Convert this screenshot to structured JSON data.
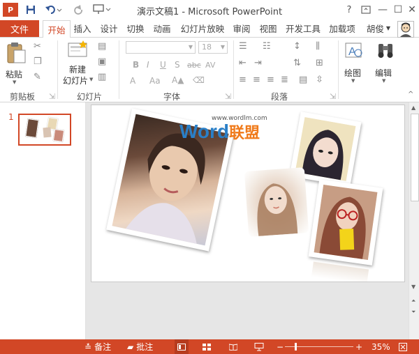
{
  "window": {
    "title": "演示文稿1 - Microsoft PowerPoint",
    "app_logo": "P",
    "help_glyph": "?",
    "minimize_glyph": "—",
    "maximize_glyph": "☐",
    "close_glyph": "✕",
    "accent": "#d24726"
  },
  "tabs": [
    {
      "label": "文件"
    },
    {
      "label": "开始"
    },
    {
      "label": "插入"
    },
    {
      "label": "设计"
    },
    {
      "label": "切换"
    },
    {
      "label": "动画"
    },
    {
      "label": "幻灯片放映"
    },
    {
      "label": "审阅"
    },
    {
      "label": "视图"
    },
    {
      "label": "开发工具"
    },
    {
      "label": "加载项"
    }
  ],
  "user": {
    "name": "胡俊"
  },
  "ribbon": {
    "paste_label": "粘贴",
    "new_slide_label_1": "新建",
    "new_slide_label_2": "幻灯片",
    "font_size_value": "18",
    "drawing_label": "绘图",
    "editing_label": "编辑",
    "groups": {
      "clipboard": "剪贴板",
      "slides": "幻灯片",
      "font": "字体",
      "paragraph": "段落"
    },
    "font_buttons": {
      "bold": "B",
      "italic": "I",
      "underline": "U",
      "shadow": "S",
      "strike": "abc",
      "spacing": "AV",
      "case": "Aa",
      "color": "A"
    }
  },
  "thumbnails": [
    {
      "number": "1"
    }
  ],
  "slide": {
    "watermark_url": "www.wordlm.com",
    "watermark_word": "Word",
    "watermark_cn": "联盟"
  },
  "statusbar": {
    "notes_label": "备注",
    "comments_label": "批注",
    "zoom_minus": "−",
    "zoom_plus": "+",
    "zoom_value": "35%",
    "zoom_fraction": 0.35
  }
}
